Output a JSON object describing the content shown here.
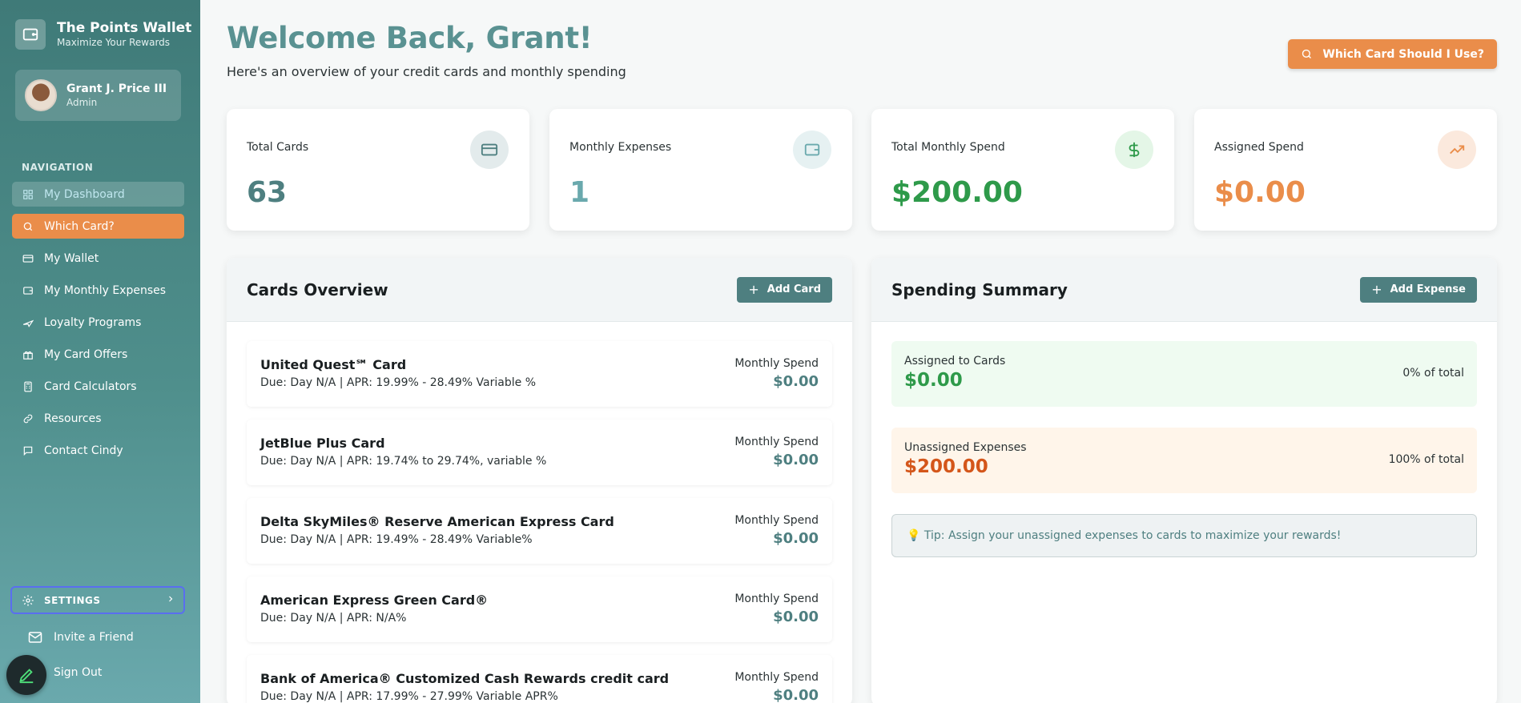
{
  "brand": {
    "title": "The Points Wallet",
    "subtitle": "Maximize Your Rewards"
  },
  "user": {
    "name": "Grant J. Price III",
    "role": "Admin"
  },
  "nav": {
    "heading": "NAVIGATION",
    "items": [
      {
        "label": "My Dashboard",
        "icon": "grid-icon"
      },
      {
        "label": "Which Card?",
        "icon": "search-icon"
      },
      {
        "label": "My Wallet",
        "icon": "credit-card-icon"
      },
      {
        "label": "My Monthly Expenses",
        "icon": "wallet-icon"
      },
      {
        "label": "Loyalty Programs",
        "icon": "plane-icon"
      },
      {
        "label": "My Card Offers",
        "icon": "gift-icon"
      },
      {
        "label": "Card Calculators",
        "icon": "calculator-icon"
      },
      {
        "label": "Resources",
        "icon": "link-icon"
      },
      {
        "label": "Contact Cindy",
        "icon": "message-icon"
      }
    ],
    "settings": "SETTINGS",
    "invite": "Invite a Friend",
    "signout": "Sign Out"
  },
  "header": {
    "welcome": "Welcome Back, Grant!",
    "subtitle": "Here's an overview of your credit cards and monthly spending",
    "cta": "Which Card Should I Use?"
  },
  "stats": [
    {
      "label": "Total Cards",
      "value": "63",
      "color": "#4e7f80"
    },
    {
      "label": "Monthly Expenses",
      "value": "1",
      "color": "#6aa9ad"
    },
    {
      "label": "Total Monthly Spend",
      "value": "$200.00",
      "color": "#2e9a4a"
    },
    {
      "label": "Assigned Spend",
      "value": "$0.00",
      "color": "#ea8d4a"
    }
  ],
  "cards_overview": {
    "title": "Cards Overview",
    "add_button": "Add Card",
    "spend_label": "Monthly Spend",
    "cards": [
      {
        "name": "United Quest℠ Card",
        "meta": "Due: Day N/A | APR: 19.99% - 28.49% Variable %",
        "spend": "$0.00"
      },
      {
        "name": "JetBlue Plus Card",
        "meta": "Due: Day N/A | APR: 19.74% to 29.74%, variable %",
        "spend": "$0.00"
      },
      {
        "name": "Delta SkyMiles® Reserve American Express Card",
        "meta": "Due: Day N/A | APR: 19.49% - 28.49% Variable%",
        "spend": "$0.00"
      },
      {
        "name": "American Express Green Card®",
        "meta": "Due: Day N/A | APR: N/A%",
        "spend": "$0.00"
      },
      {
        "name": "Bank of America® Customized Cash Rewards credit card",
        "meta": "Due: Day N/A | APR: 17.99% - 27.99% Variable APR%",
        "spend": "$0.00"
      }
    ]
  },
  "spending_summary": {
    "title": "Spending Summary",
    "add_button": "Add Expense",
    "assigned": {
      "label": "Assigned to Cards",
      "value": "$0.00",
      "pct": "0% of total"
    },
    "unassigned": {
      "label": "Unassigned Expenses",
      "value": "$200.00",
      "pct": "100% of total"
    },
    "tip": "💡 Tip: Assign your unassigned expenses to cards to maximize your rewards!"
  }
}
